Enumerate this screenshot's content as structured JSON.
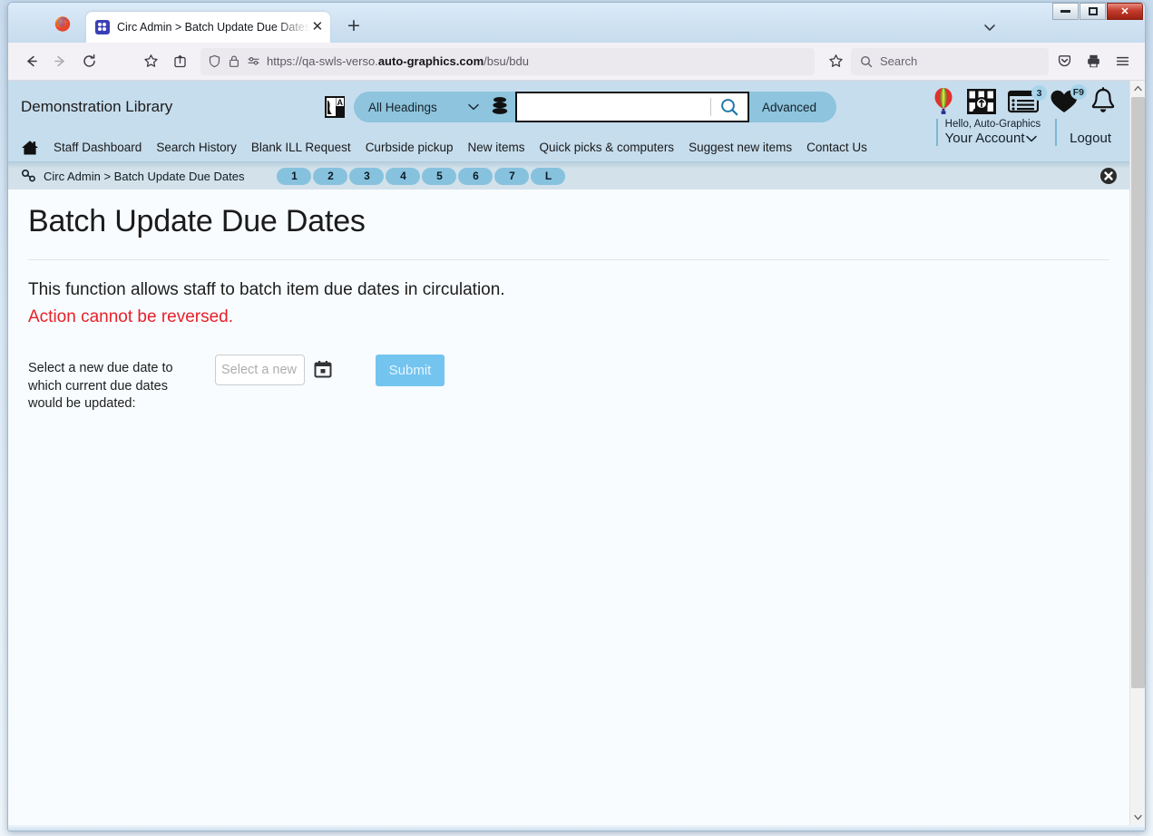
{
  "browser": {
    "tab": {
      "title": "Circ Admin > Batch Update Due Dates",
      "close_label": "✕",
      "favicon_name": "verso-favicon"
    },
    "new_tab_label": "+",
    "window_controls": {
      "minimize": "",
      "maximize": "",
      "close": "✕"
    },
    "url": "https://qa-swls-verso.auto-graphics.com/bsu/bdu",
    "url_prefix": "https://qa-swls-verso.",
    "url_domain": "auto-graphics.com",
    "url_path": "/bsu/bdu",
    "search_placeholder": "Search"
  },
  "header": {
    "library_name": "Demonstration Library",
    "search": {
      "scope_selected": "All Headings",
      "query_value": "",
      "query_placeholder": "",
      "advanced_label": "Advanced"
    },
    "icons": [
      {
        "name": "balloon-icon",
        "badge": ""
      },
      {
        "name": "book-search-icon",
        "badge": ""
      },
      {
        "name": "my-lists-icon",
        "badge": "3"
      },
      {
        "name": "favorites-heart-icon",
        "badge": "F9"
      },
      {
        "name": "notifications-bell-icon",
        "badge": ""
      }
    ],
    "account": {
      "greeting": "Hello, Auto-Graphics",
      "name": "Your Account",
      "chevron": "⌄",
      "logout": "Logout"
    }
  },
  "nav": {
    "home_icon": "home-icon",
    "links": [
      "Staff Dashboard",
      "Search History",
      "Blank ILL Request",
      "Curbside pickup",
      "New items",
      "Quick picks & computers",
      "Suggest new items",
      "Contact Us"
    ]
  },
  "breadcrumb": {
    "icon": "link-chain-icon",
    "text": "Circ Admin > Batch Update Due Dates",
    "pills": [
      "1",
      "2",
      "3",
      "4",
      "5",
      "6",
      "7",
      "L"
    ],
    "close_label": "✕"
  },
  "main": {
    "title": "Batch Update Due Dates",
    "intro": "This function allows staff to batch item due dates in circulation.",
    "warning": "Action cannot be reversed.",
    "warning_color": "#e8202a",
    "form": {
      "label": "Select a new due date to which current due dates would be updated:",
      "date_value": "",
      "date_placeholder": "Select a new",
      "calendar_icon": "calendar-icon",
      "submit_label": "Submit",
      "submit_color": "#74c4f0"
    }
  },
  "scrollbar": {
    "up": "▲",
    "down": "▼"
  },
  "colors": {
    "header_bg": "#c6dded",
    "crumb_bg": "#d2e1ea",
    "pill_bg": "#86c2de",
    "search_pill_bg": "#8ec4dd",
    "page_bg": "#f8fcff"
  }
}
